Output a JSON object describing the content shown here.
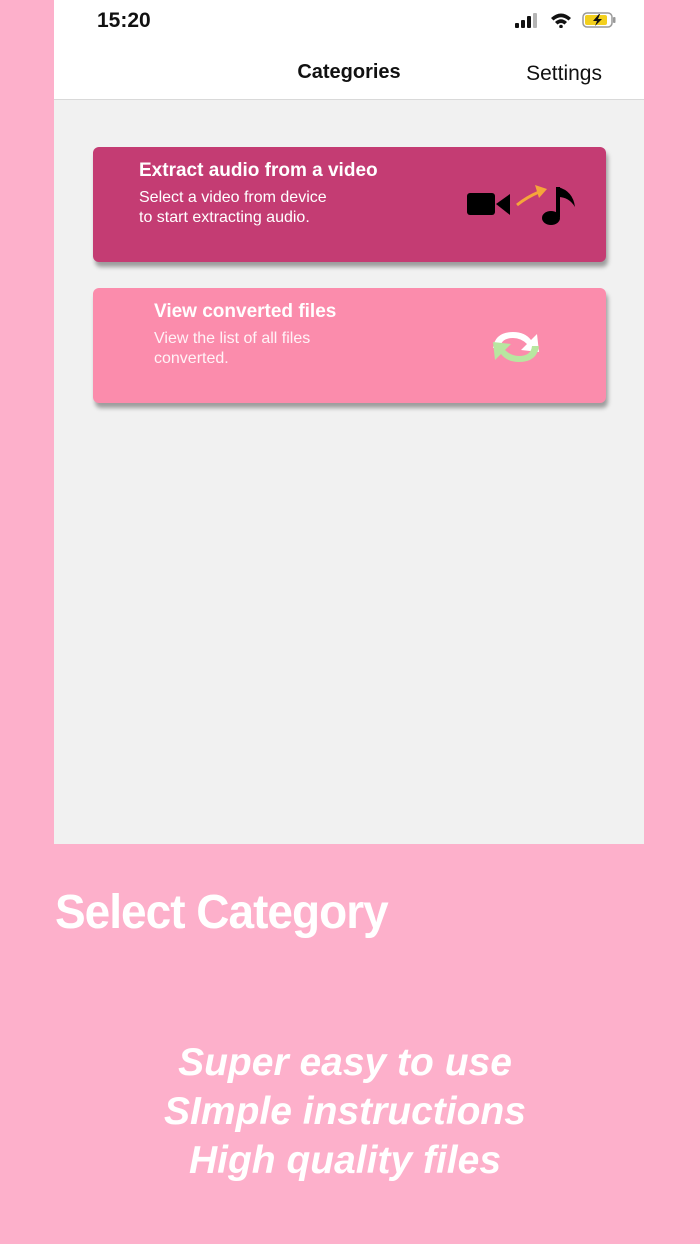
{
  "status": {
    "time": "15:20"
  },
  "nav": {
    "title": "Categories",
    "settings_label": "Settings"
  },
  "cards": [
    {
      "title": "Extract audio from a video",
      "line1": "Select a video from device",
      "line2": "to start extracting audio.",
      "icon": "video-to-music-icon",
      "color": "#c43c73"
    },
    {
      "title": "View converted files",
      "line1": "View the list of all files",
      "line2": "converted.",
      "icon": "refresh-icon",
      "color": "#fb8cac"
    }
  ],
  "promo": {
    "title": "Select Category",
    "lines": [
      "Super easy to use",
      "SImple instructions",
      "High quality files"
    ]
  },
  "colors": {
    "background": "#fdb0cb",
    "accent": "#c43c73",
    "light_card": "#fb8cac"
  }
}
